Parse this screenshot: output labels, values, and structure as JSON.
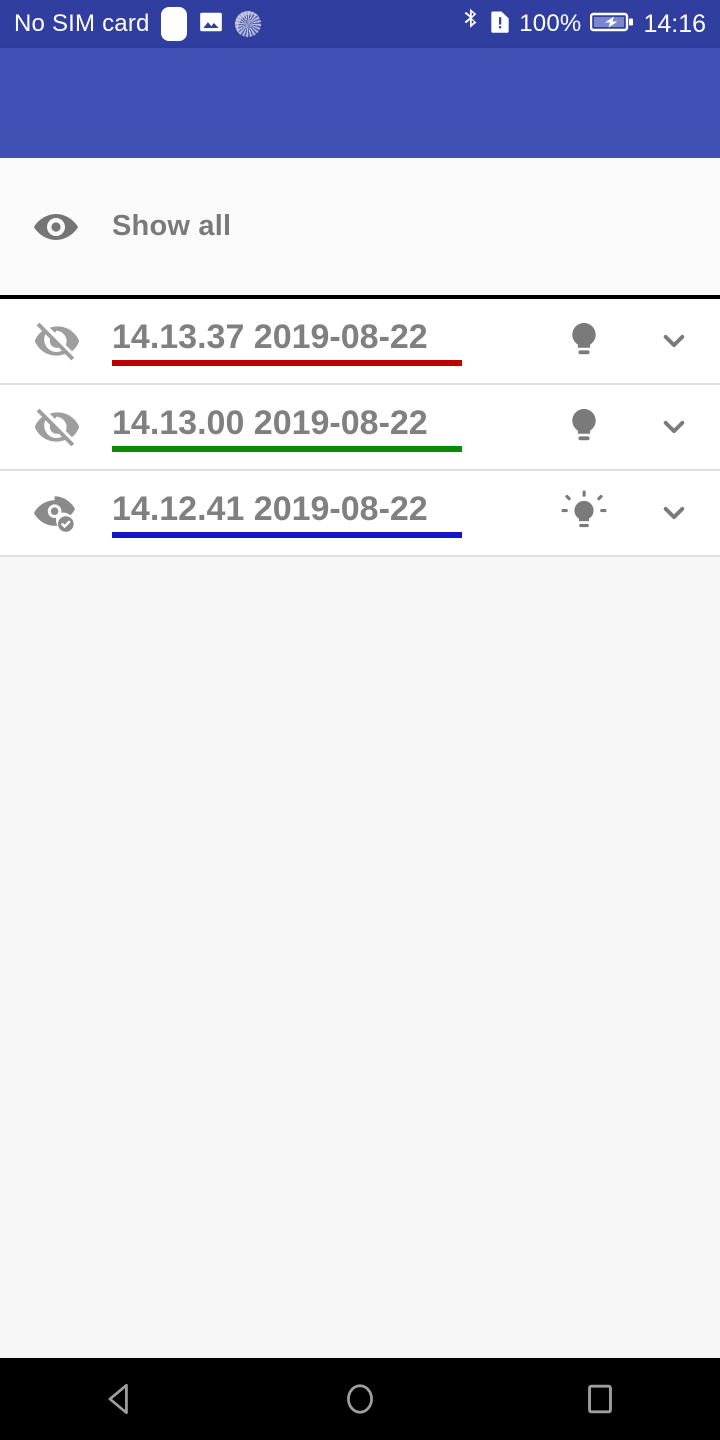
{
  "statusbar": {
    "carrier_text": "No SIM card",
    "clock": "14:16",
    "battery_percent": "100%",
    "icons": [
      "sim-blank-icon",
      "image-icon",
      "sync-spinner-icon",
      "bluetooth-icon",
      "sim-alert-icon",
      "battery-charging-icon"
    ],
    "background_color": "#303F9F",
    "foreground_color": "#FFFFFF"
  },
  "appbar": {
    "title": "",
    "background_color": "#3F51B5"
  },
  "show_all": {
    "label": "Show all",
    "icon": "eye-icon",
    "text_color": "#7A7A7A"
  },
  "list": {
    "rows": [
      {
        "title": "14.13.37 2019-08-22",
        "underline_color": "#BB0000",
        "visibility_icon": "eye-off-icon",
        "bulb_icon": "lightbulb-off-icon",
        "expand_icon": "chevron-down-icon"
      },
      {
        "title": "14.13.00 2019-08-22",
        "underline_color": "#0B8A08",
        "visibility_icon": "eye-off-icon",
        "bulb_icon": "lightbulb-off-icon",
        "expand_icon": "chevron-down-icon"
      },
      {
        "title": "14.12.41 2019-08-22",
        "underline_color": "#1414CC",
        "visibility_icon": "eye-check-icon",
        "bulb_icon": "lightbulb-on-icon",
        "expand_icon": "chevron-down-icon"
      }
    ]
  },
  "navbar": {
    "back_label": "back-icon",
    "home_label": "home-icon",
    "recents_label": "recents-icon",
    "background_color": "#000000"
  }
}
